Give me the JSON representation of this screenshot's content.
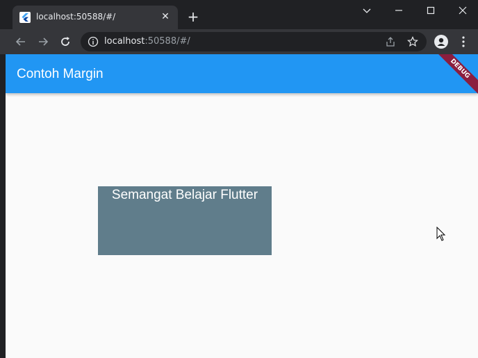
{
  "browser": {
    "tab_title": "localhost:50588/#/",
    "tab_close": "✕",
    "new_tab": "+",
    "url_host": "localhost",
    "url_rest": ":50588/#/"
  },
  "app": {
    "title": "Contoh Margin",
    "debug_label": "DEBUG",
    "container_text": "Semangat Belajar Flutter"
  },
  "colors": {
    "appbar": "#2196f3",
    "container": "#607d8b",
    "debug_banner": "#8b1e3f",
    "page_background": "#fafafa"
  },
  "icons": [
    "flutter-favicon-icon",
    "back-arrow-icon",
    "forward-arrow-icon",
    "reload-icon",
    "info-icon",
    "share-icon",
    "star-icon",
    "profile-icon",
    "menu-dots-icon",
    "minimize-icon",
    "maximize-icon",
    "close-window-icon",
    "tab-search-chevron-icon",
    "mouse-cursor-icon"
  ]
}
